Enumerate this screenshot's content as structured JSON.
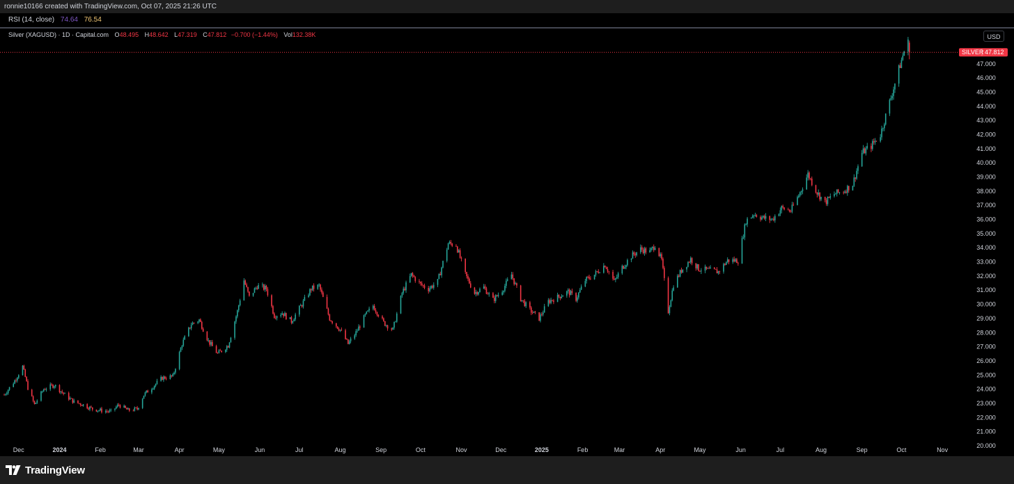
{
  "header": {
    "credit": "ronnie10166 created with TradingView.com, Oct 07, 2025 21:26 UTC"
  },
  "rsi": {
    "label": "RSI (14, close)",
    "value1": "74.64",
    "value2": "76.54"
  },
  "legend": {
    "symbol": "Silver (XAGUSD) · 1D · Capital.com",
    "open_label": "O",
    "open": "48.495",
    "high_label": "H",
    "high": "48.642",
    "low_label": "L",
    "low": "47.319",
    "close_label": "C",
    "close": "47.812",
    "change": "−0.700 (−1.44%)",
    "vol_label": "Vol",
    "vol": "132.38K"
  },
  "currency": "USD",
  "price_tag": {
    "name": "SILVER",
    "value": "47.812"
  },
  "brand": {
    "name": "TradingView"
  },
  "colors": {
    "up": "#26a69a",
    "down": "#f23645",
    "background": "#000000",
    "axis_text": "#d1d4dc",
    "price_line": "#f23645"
  },
  "chart_data": {
    "type": "candlestick",
    "title": "Silver (XAGUSD) · 1D · Capital.com",
    "xlabel": "",
    "ylabel": "",
    "ylim": [
      20,
      49.2
    ],
    "grid": false,
    "y_ticks": [
      "20.000",
      "21.000",
      "22.000",
      "23.000",
      "24.000",
      "25.000",
      "26.000",
      "27.000",
      "28.000",
      "29.000",
      "30.000",
      "31.000",
      "32.000",
      "33.000",
      "34.000",
      "35.000",
      "36.000",
      "37.000",
      "38.000",
      "39.000",
      "40.000",
      "41.000",
      "42.000",
      "43.000",
      "44.000",
      "45.000",
      "46.000",
      "47.000"
    ],
    "x_ticks": [
      {
        "label": "Dec",
        "date": "2023-12-01",
        "bold": false
      },
      {
        "label": "2024",
        "date": "2024-01-01",
        "bold": true
      },
      {
        "label": "Feb",
        "date": "2024-02-01",
        "bold": false
      },
      {
        "label": "Mar",
        "date": "2024-03-01",
        "bold": false
      },
      {
        "label": "Apr",
        "date": "2024-04-01",
        "bold": false
      },
      {
        "label": "May",
        "date": "2024-05-01",
        "bold": false
      },
      {
        "label": "Jun",
        "date": "2024-06-01",
        "bold": false
      },
      {
        "label": "Jul",
        "date": "2024-07-01",
        "bold": false
      },
      {
        "label": "Aug",
        "date": "2024-08-01",
        "bold": false
      },
      {
        "label": "Sep",
        "date": "2024-09-01",
        "bold": false
      },
      {
        "label": "Oct",
        "date": "2024-10-01",
        "bold": false
      },
      {
        "label": "Nov",
        "date": "2024-11-01",
        "bold": false
      },
      {
        "label": "Dec",
        "date": "2024-12-01",
        "bold": false
      },
      {
        "label": "2025",
        "date": "2025-01-01",
        "bold": true
      },
      {
        "label": "Feb",
        "date": "2025-02-01",
        "bold": false
      },
      {
        "label": "Mar",
        "date": "2025-03-01",
        "bold": false
      },
      {
        "label": "Apr",
        "date": "2025-04-01",
        "bold": false
      },
      {
        "label": "May",
        "date": "2025-05-01",
        "bold": false
      },
      {
        "label": "Jun",
        "date": "2025-06-01",
        "bold": false
      },
      {
        "label": "Jul",
        "date": "2025-07-01",
        "bold": false
      },
      {
        "label": "Aug",
        "date": "2025-08-01",
        "bold": false
      },
      {
        "label": "Sep",
        "date": "2025-09-01",
        "bold": false
      },
      {
        "label": "Oct",
        "date": "2025-10-01",
        "bold": false
      },
      {
        "label": "Nov",
        "date": "2025-11-01",
        "bold": false
      }
    ],
    "x_start": "2023-11-20",
    "x_end": "2025-11-11",
    "close_path": [
      [
        "2023-11-20",
        23.6
      ],
      [
        "2023-11-28",
        24.6
      ],
      [
        "2023-12-04",
        25.6
      ],
      [
        "2023-12-08",
        24.1
      ],
      [
        "2023-12-13",
        22.9
      ],
      [
        "2023-12-20",
        24.0
      ],
      [
        "2023-12-28",
        24.3
      ],
      [
        "2024-01-05",
        23.6
      ],
      [
        "2024-01-12",
        23.1
      ],
      [
        "2024-01-19",
        22.9
      ],
      [
        "2024-01-26",
        22.6
      ],
      [
        "2024-02-01",
        22.5
      ],
      [
        "2024-02-09",
        22.4
      ],
      [
        "2024-02-15",
        22.9
      ],
      [
        "2024-02-22",
        22.5
      ],
      [
        "2024-02-29",
        22.6
      ],
      [
        "2024-03-05",
        23.6
      ],
      [
        "2024-03-12",
        24.2
      ],
      [
        "2024-03-19",
        24.8
      ],
      [
        "2024-03-27",
        24.9
      ],
      [
        "2024-04-03",
        27.2
      ],
      [
        "2024-04-10",
        28.6
      ],
      [
        "2024-04-16",
        28.9
      ],
      [
        "2024-04-23",
        27.4
      ],
      [
        "2024-04-30",
        26.5
      ],
      [
        "2024-05-08",
        27.1
      ],
      [
        "2024-05-15",
        29.5
      ],
      [
        "2024-05-20",
        31.7
      ],
      [
        "2024-05-24",
        30.5
      ],
      [
        "2024-05-30",
        31.3
      ],
      [
        "2024-06-06",
        31.1
      ],
      [
        "2024-06-12",
        29.2
      ],
      [
        "2024-06-18",
        29.4
      ],
      [
        "2024-06-25",
        28.8
      ],
      [
        "2024-07-03",
        30.0
      ],
      [
        "2024-07-10",
        31.1
      ],
      [
        "2024-07-16",
        31.3
      ],
      [
        "2024-07-24",
        29.0
      ],
      [
        "2024-08-01",
        28.2
      ],
      [
        "2024-08-07",
        27.2
      ],
      [
        "2024-08-13",
        28.0
      ],
      [
        "2024-08-20",
        29.2
      ],
      [
        "2024-08-26",
        29.9
      ],
      [
        "2024-09-03",
        28.7
      ],
      [
        "2024-09-10",
        28.2
      ],
      [
        "2024-09-17",
        30.8
      ],
      [
        "2024-09-24",
        32.1
      ],
      [
        "2024-10-01",
        31.4
      ],
      [
        "2024-10-07",
        31.1
      ],
      [
        "2024-10-14",
        31.6
      ],
      [
        "2024-10-22",
        34.3
      ],
      [
        "2024-10-28",
        34.2
      ],
      [
        "2024-11-04",
        32.1
      ],
      [
        "2024-11-11",
        30.8
      ],
      [
        "2024-11-18",
        31.2
      ],
      [
        "2024-11-25",
        30.3
      ],
      [
        "2024-12-02",
        31.0
      ],
      [
        "2024-12-09",
        32.1
      ],
      [
        "2024-12-16",
        30.4
      ],
      [
        "2024-12-23",
        29.6
      ],
      [
        "2024-12-30",
        29.0
      ],
      [
        "2025-01-06",
        30.2
      ],
      [
        "2025-01-13",
        30.5
      ],
      [
        "2025-01-21",
        30.9
      ],
      [
        "2025-01-27",
        30.4
      ],
      [
        "2025-02-03",
        31.7
      ],
      [
        "2025-02-10",
        32.1
      ],
      [
        "2025-02-18",
        32.8
      ],
      [
        "2025-02-25",
        31.6
      ],
      [
        "2025-03-03",
        32.6
      ],
      [
        "2025-03-10",
        33.4
      ],
      [
        "2025-03-17",
        33.9
      ],
      [
        "2025-03-24",
        33.7
      ],
      [
        "2025-03-28",
        34.2
      ],
      [
        "2025-04-02",
        33.1
      ],
      [
        "2025-04-07",
        29.5
      ],
      [
        "2025-04-11",
        31.4
      ],
      [
        "2025-04-17",
        32.4
      ],
      [
        "2025-04-24",
        33.2
      ],
      [
        "2025-04-30",
        32.5
      ],
      [
        "2025-05-08",
        32.4
      ],
      [
        "2025-05-15",
        32.3
      ],
      [
        "2025-05-22",
        33.1
      ],
      [
        "2025-05-30",
        33.1
      ],
      [
        "2025-06-05",
        35.9
      ],
      [
        "2025-06-11",
        36.4
      ],
      [
        "2025-06-18",
        36.1
      ],
      [
        "2025-06-25",
        36.0
      ],
      [
        "2025-07-02",
        36.8
      ],
      [
        "2025-07-09",
        36.6
      ],
      [
        "2025-07-16",
        37.9
      ],
      [
        "2025-07-22",
        39.2
      ],
      [
        "2025-07-29",
        37.9
      ],
      [
        "2025-08-04",
        37.2
      ],
      [
        "2025-08-11",
        37.8
      ],
      [
        "2025-08-18",
        38.0
      ],
      [
        "2025-08-25",
        38.5
      ],
      [
        "2025-09-01",
        40.7
      ],
      [
        "2025-09-08",
        41.2
      ],
      [
        "2025-09-15",
        42.0
      ],
      [
        "2025-09-22",
        44.3
      ],
      [
        "2025-09-29",
        46.6
      ],
      [
        "2025-10-03",
        47.9
      ],
      [
        "2025-10-06",
        48.5
      ],
      [
        "2025-10-07",
        47.812
      ]
    ],
    "last_close": 47.812
  }
}
